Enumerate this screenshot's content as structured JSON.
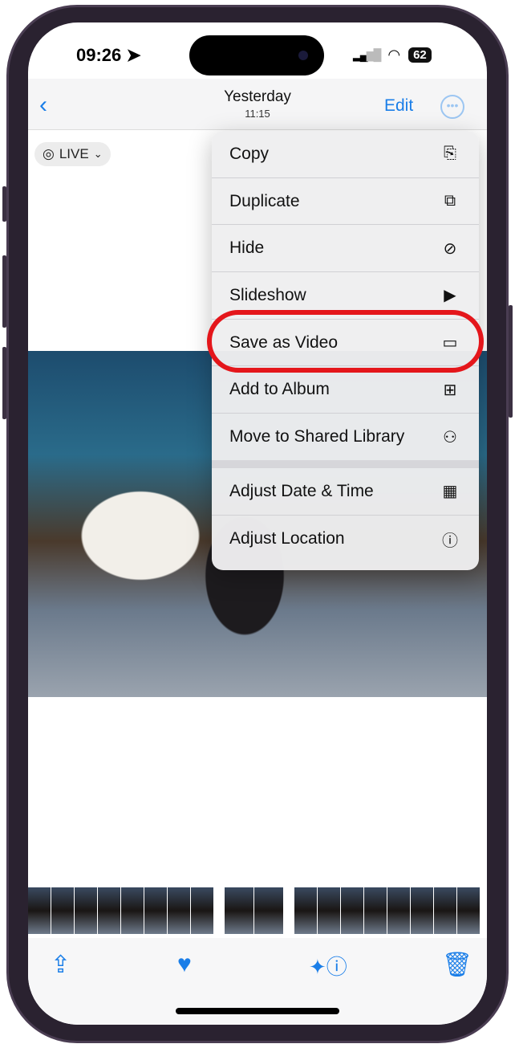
{
  "status": {
    "time": "09:26",
    "battery": "62"
  },
  "nav": {
    "title": "Yesterday",
    "subtitle": "11:15",
    "edit_label": "Edit"
  },
  "live_label": "LIVE",
  "menu": {
    "items": [
      {
        "label": "Copy",
        "icon": "copy-icon",
        "glyph": "⎘"
      },
      {
        "label": "Duplicate",
        "icon": "duplicate-icon",
        "glyph": "⧉"
      },
      {
        "label": "Hide",
        "icon": "eye-slash-icon",
        "glyph": "⊘"
      },
      {
        "label": "Slideshow",
        "icon": "play-rectangle-icon",
        "glyph": "▶"
      },
      {
        "label": "Save as Video",
        "icon": "video-camera-icon",
        "glyph": "▭"
      },
      {
        "label": "Add to Album",
        "icon": "add-album-icon",
        "glyph": "⊞"
      },
      {
        "label": "Move to Shared Library",
        "icon": "people-icon",
        "glyph": "⚇"
      },
      {
        "label": "Adjust Date & Time",
        "icon": "calendar-clock-icon",
        "glyph": "▦"
      },
      {
        "label": "Adjust Location",
        "icon": "location-info-icon",
        "glyph": "ⓘ"
      }
    ]
  },
  "highlight": {
    "item": "Save as Video",
    "color": "#e4161b"
  },
  "accent": "#1a7ee8"
}
